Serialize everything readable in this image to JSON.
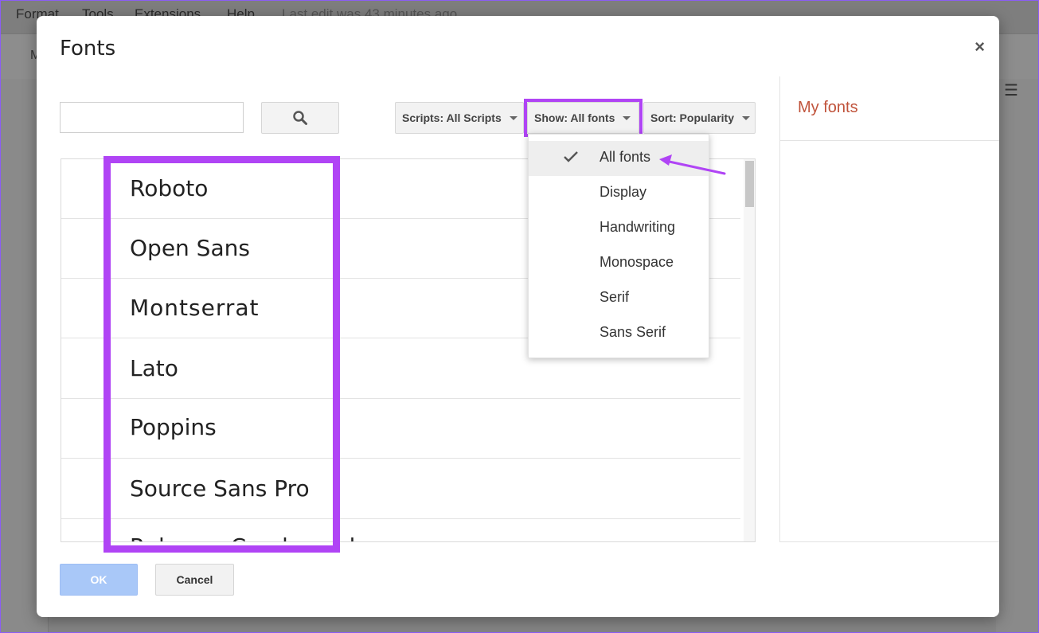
{
  "background": {
    "menu_items": [
      "Format",
      "Tools",
      "Extensions",
      "Help"
    ],
    "last_edit": "Last edit was 43 minutes ago",
    "toolbar_fragment": "M"
  },
  "dialog": {
    "title": "Fonts",
    "close_symbol": "×",
    "search": {
      "value": "",
      "placeholder": ""
    },
    "filters": {
      "scripts": "Scripts: All Scripts",
      "show": "Show: All fonts",
      "sort": "Sort: Popularity"
    },
    "show_menu": {
      "options": [
        "All fonts",
        "Display",
        "Handwriting",
        "Monospace",
        "Serif",
        "Sans Serif"
      ],
      "selected": "All fonts"
    },
    "font_list": [
      "Roboto",
      "Open Sans",
      "Montserrat",
      "Lato",
      "Poppins",
      "Source Sans Pro",
      "Raleway Condensed"
    ],
    "my_fonts_title": "My fonts",
    "ok_label": "OK",
    "cancel_label": "Cancel"
  },
  "colors": {
    "highlight": "#b044f5",
    "my_fonts": "#c0533b",
    "ok_button": "#a9c8f8"
  }
}
